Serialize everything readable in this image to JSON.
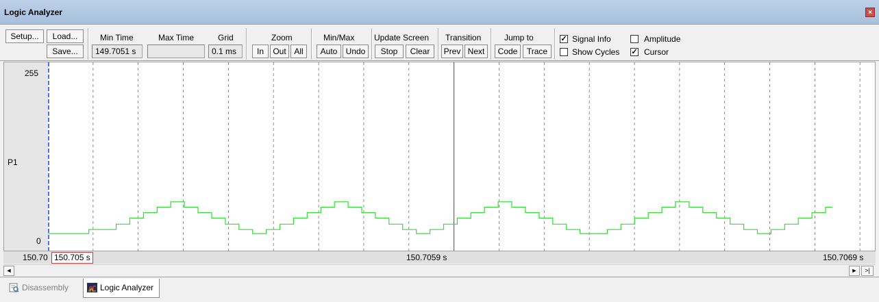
{
  "window": {
    "title": "Logic Analyzer",
    "close_glyph": "×"
  },
  "toolbar": {
    "setup": "Setup...",
    "load": "Load...",
    "save": "Save...",
    "min_time_label": "Min Time",
    "min_time_value": "149.7051 s",
    "max_time_label": "Max Time",
    "max_time_value": "",
    "grid_label": "Grid",
    "grid_value": "0.1 ms",
    "zoom_label": "Zoom",
    "zoom_in": "In",
    "zoom_out": "Out",
    "zoom_all": "All",
    "minmax_label": "Min/Max",
    "minmax_auto": "Auto",
    "minmax_undo": "Undo",
    "update_label": "Update Screen",
    "update_stop": "Stop",
    "update_clear": "Clear",
    "transition_label": "Transition",
    "transition_prev": "Prev",
    "transition_next": "Next",
    "jump_label": "Jump to",
    "jump_code": "Code",
    "jump_trace": "Trace",
    "signal_info": "Signal Info",
    "signal_info_checked": true,
    "amplitude": "Amplitude",
    "amplitude_checked": false,
    "show_cycles": "Show Cycles",
    "show_cycles_checked": false,
    "cursor": "Cursor",
    "cursor_checked": true
  },
  "plot": {
    "y_max": "255",
    "y_min": "0",
    "signal_name": "P1",
    "trace_color": "#33dd33",
    "grid_color": "#000000",
    "cursor_color": "#1a3cff"
  },
  "timeline": {
    "left": "150.70",
    "cursor": "150.705 s",
    "center": "150.7059 s",
    "right": "150.7069 s"
  },
  "scrollbar": {
    "left_glyph": "◄",
    "right_glyph": "►",
    "end_glyph": ">|"
  },
  "tabs": [
    {
      "label": "Disassembly",
      "active": false,
      "icon": "disassembly-icon"
    },
    {
      "label": "Logic Analyzer",
      "active": true,
      "icon": "logic-analyzer-icon"
    }
  ],
  "chart_data": {
    "type": "line",
    "series": [
      {
        "name": "P1",
        "x_ms": [
          0.0,
          0.01,
          0.02,
          0.03,
          0.04,
          0.05,
          0.055,
          0.06,
          0.065,
          0.07,
          0.075,
          0.08,
          0.085,
          0.09,
          0.095,
          0.1,
          0.105,
          0.11,
          0.115,
          0.12,
          0.125,
          0.13,
          0.14,
          0.15,
          0.155,
          0.16,
          0.165,
          0.17,
          0.175,
          0.18,
          0.185,
          0.19,
          0.195,
          0.2,
          0.205,
          0.21,
          0.215,
          0.22,
          0.23,
          0.24,
          0.245,
          0.25,
          0.255,
          0.26,
          0.265,
          0.27,
          0.275,
          0.28,
          0.285,
          0.29,
          0.295,
          0.3,
          0.305,
          0.31,
          0.32,
          0.33,
          0.335,
          0.34,
          0.345,
          0.35,
          0.355,
          0.36,
          0.365,
          0.37,
          0.375,
          0.38,
          0.385,
          0.39,
          0.395,
          0.4,
          0.41,
          0.42,
          0.425,
          0.43,
          0.435,
          0.44,
          0.445,
          0.45,
          0.455,
          0.46,
          0.465,
          0.47,
          0.475,
          0.48,
          0.485,
          0.49,
          0.5,
          0.51,
          0.515,
          0.52,
          0.525,
          0.53,
          0.535,
          0.54,
          0.545,
          0.55,
          0.555,
          0.56,
          0.565,
          0.57,
          0.575
        ],
        "y": [
          12,
          12,
          12,
          18,
          18,
          26,
          26,
          35,
          35,
          43,
          43,
          51,
          51,
          59,
          59,
          51,
          51,
          43,
          43,
          35,
          35,
          26,
          18,
          12,
          12,
          18,
          18,
          26,
          26,
          35,
          35,
          43,
          43,
          51,
          51,
          59,
          59,
          51,
          43,
          35,
          35,
          26,
          26,
          18,
          18,
          12,
          12,
          18,
          18,
          26,
          26,
          35,
          35,
          43,
          51,
          59,
          59,
          51,
          51,
          43,
          43,
          35,
          35,
          26,
          26,
          18,
          18,
          12,
          12,
          12,
          18,
          26,
          26,
          35,
          35,
          43,
          43,
          51,
          51,
          59,
          59,
          51,
          51,
          43,
          43,
          35,
          26,
          18,
          18,
          12,
          12,
          18,
          18,
          26,
          26,
          35,
          35,
          43,
          43,
          51,
          51
        ]
      }
    ],
    "ylim": [
      0,
      255
    ],
    "grid": true
  }
}
